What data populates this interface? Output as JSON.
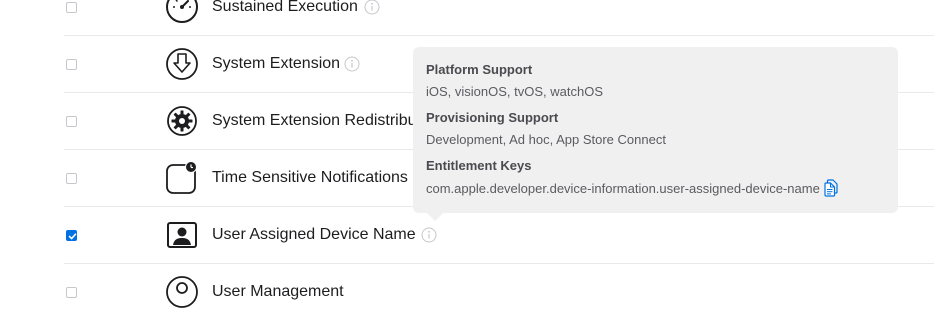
{
  "capabilities": [
    {
      "name": "Sustained Execution",
      "checked": false,
      "icon": "gauge-icon"
    },
    {
      "name": "System Extension",
      "checked": false,
      "icon": "download-circle-icon"
    },
    {
      "name": "System Extension Redistribution",
      "checked": false,
      "icon": "gear-icon"
    },
    {
      "name": "Time Sensitive Notifications",
      "checked": false,
      "icon": "notification-badge-icon"
    },
    {
      "name": "User Assigned Device Name",
      "checked": true,
      "icon": "person-card-icon"
    },
    {
      "name": "User Management",
      "checked": false,
      "icon": "person-circle-icon"
    }
  ],
  "tooltip": {
    "platform_heading": "Platform Support",
    "platform_value": "iOS, visionOS, tvOS, watchOS",
    "provisioning_heading": "Provisioning Support",
    "provisioning_value": "Development, Ad hoc, App Store Connect",
    "entitlement_heading": "Entitlement Keys",
    "entitlement_value": "com.apple.developer.device-information.user-assigned-device-name"
  },
  "colors": {
    "accent": "#0071e3",
    "tooltip_bg": "#f0f0f0",
    "divider": "#e8e8ed"
  }
}
